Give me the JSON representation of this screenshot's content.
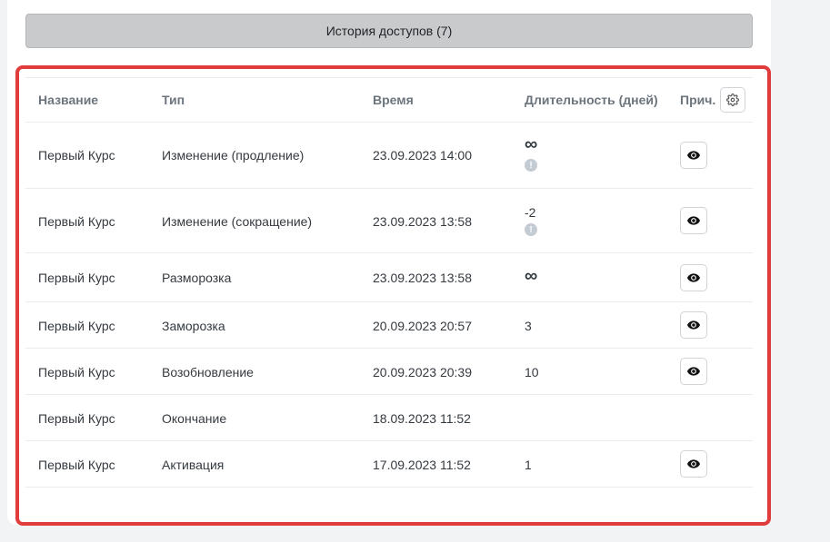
{
  "history_button": {
    "label": "История доступов (7)"
  },
  "table": {
    "headers": {
      "name": "Название",
      "type": "Тип",
      "time": "Время",
      "duration": "Длительность (дней)",
      "reason": "Прич."
    },
    "rows": [
      {
        "name": "Первый Курс",
        "type": "Изменение (продление)",
        "time": "23.09.2023 14:00",
        "duration": "∞",
        "info": "!"
      },
      {
        "name": "Первый Курс",
        "type": "Изменение (сокращение)",
        "time": "23.09.2023 13:58",
        "duration": "-2",
        "info": "!"
      },
      {
        "name": "Первый Курс",
        "type": "Разморозка",
        "time": "23.09.2023 13:58",
        "duration": "∞"
      },
      {
        "name": "Первый Курс",
        "type": "Заморозка",
        "time": "20.09.2023 20:57",
        "duration": "3"
      },
      {
        "name": "Первый Курс",
        "type": "Возобновление",
        "time": "20.09.2023 20:39",
        "duration": "10"
      },
      {
        "name": "Первый Курс",
        "type": "Окончание",
        "time": "18.09.2023 11:52",
        "duration": ""
      },
      {
        "name": "Первый Курс",
        "type": "Активация",
        "time": "17.09.2023 11:52",
        "duration": "1"
      }
    ]
  },
  "icons": {
    "settings": "gear-icon",
    "view": "eye-icon",
    "info": "info-icon"
  },
  "colors": {
    "highlight": "#e03c3c",
    "button_bg": "#c9cacc"
  }
}
